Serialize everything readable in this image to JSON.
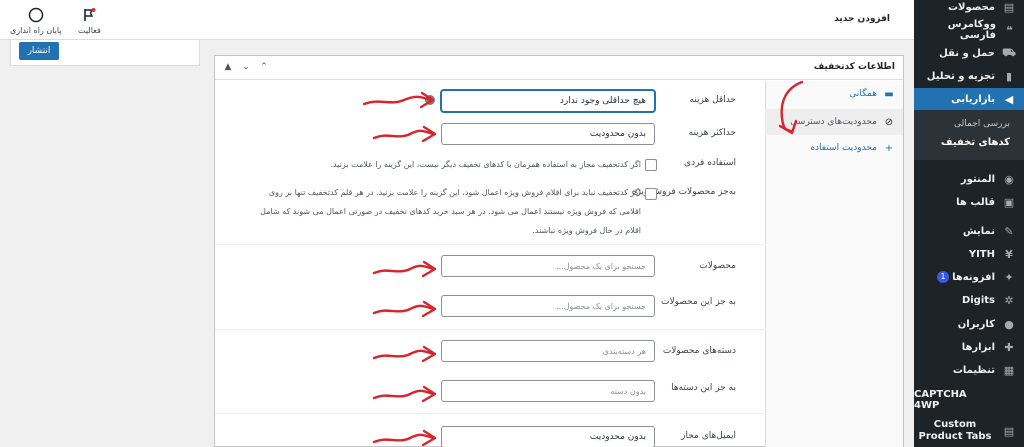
{
  "sidebar": {
    "items": [
      {
        "label": "محصولات",
        "icon": "products-icon",
        "glyph": "▤"
      },
      {
        "label": "ووکامرس فارسی",
        "icon": "chat-icon",
        "glyph": "❝"
      },
      {
        "label": "حمل و نقل",
        "icon": "truck-icon",
        "glyph": "⛟"
      },
      {
        "label": "تجزیه و تحلیل",
        "icon": "analytics-icon",
        "glyph": "▮"
      },
      {
        "label": "بازاریابی",
        "icon": "megaphone-icon",
        "glyph": "◀"
      },
      {
        "label": "المنتور",
        "icon": "elementor-icon",
        "glyph": "◉"
      },
      {
        "label": "قالب ها",
        "icon": "templates-icon",
        "glyph": "▣"
      },
      {
        "label": "نمایش",
        "icon": "appearance-icon",
        "glyph": "✎"
      },
      {
        "label": "YITH",
        "icon": "yith-icon",
        "glyph": "¥"
      },
      {
        "label": "افزونه‌ها",
        "icon": "plugins-icon",
        "glyph": "✦",
        "badge": "1"
      },
      {
        "label": "Digits",
        "icon": "digits-icon",
        "glyph": "✲"
      },
      {
        "label": "کاربران",
        "icon": "users-icon",
        "glyph": "●"
      },
      {
        "label": "ابزارها",
        "icon": "tools-icon",
        "glyph": "✚"
      },
      {
        "label": "تنظیمات",
        "icon": "settings-icon",
        "glyph": "▦"
      },
      {
        "label": "CAPTCHA 4WP",
        "icon": "captcha-icon",
        "glyph": ""
      },
      {
        "label": "Custom Product Tabs",
        "icon": "product-tabs-icon",
        "glyph": "▤"
      }
    ],
    "submenu": {
      "overview": "بررسی اجمالی",
      "coupons": "کدهای تخفیف"
    }
  },
  "topbar": {
    "heading": "افزودن جدید",
    "activity": "فعالیت",
    "finish_setup": "پایان راه اندازی"
  },
  "publish": {
    "button": "انتشار"
  },
  "panel": {
    "title": "اطلاعات کدتخفیف",
    "tabs": [
      {
        "label": "همگانی",
        "icon": "ticket-icon",
        "glyph": "▬"
      },
      {
        "label": "محدودیت‌های دسترسی",
        "icon": "restriction-icon",
        "glyph": "⊘"
      },
      {
        "label": "محدودیت استفاده",
        "icon": "plus-icon",
        "glyph": "+"
      }
    ],
    "fields": {
      "min_spend_label": "حداقل هزینه",
      "min_spend_value": "هیچ حداقلی وجود ندارد",
      "max_spend_label": "حداکثر هزینه",
      "max_spend_value": "بدون محدودیت",
      "individual_label": "استفاده فردی",
      "individual_desc": "اگر کدتخفیف مجاز به استفاده همزمان با کدهای تخفیف دیگر نیست، این گزینه را علامت بزنید.",
      "exclude_sale_label": "به‌جز محصولات فروش ویژه",
      "exclude_sale_desc_1": "اگر کدتخفیف نباید برای اقلام فروش ویژه اعمال شود، این گزینه را علامت بزنید. در هر قلم کدتخفیف تنها بر روی",
      "exclude_sale_desc_2": "اقلامی که فروش ویژه نیستند اعمال می شود. در هر سبد خرید کدهای تخفیف در صورتی اعمال می شوند که شامل",
      "exclude_sale_desc_3": "اقلام در حال فروش ویژه نباشند.",
      "products_label": "محصولات",
      "products_placeholder": "جستجو برای یک محصول...",
      "exclude_products_label": "به جز این محصولات",
      "exclude_products_placeholder": "جستجو برای یک محصول...",
      "categories_label": "دسته‌های محصولات",
      "categories_placeholder": "هر دسته‌بندی",
      "exclude_categories_label": "به جز این دسته‌ها",
      "exclude_categories_placeholder": "بدون دسته",
      "emails_label": "ایمیل‌های مجاز",
      "emails_value": "بدون محدودیت"
    }
  },
  "colors": {
    "accent": "#2271b1",
    "sidebar_bg": "#1d2327",
    "annotation_arrow": "#d9232d"
  }
}
